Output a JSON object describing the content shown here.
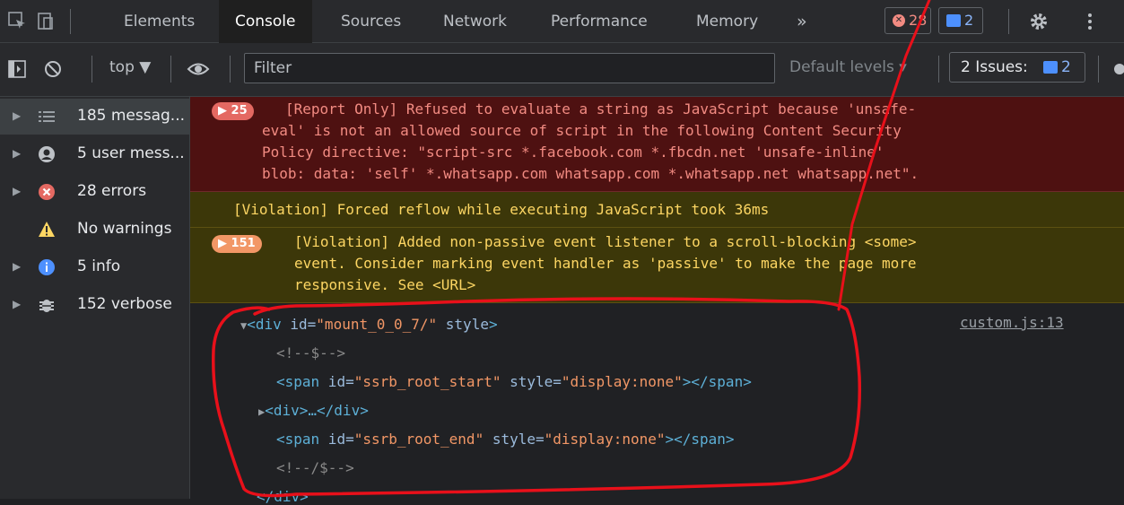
{
  "tabs": {
    "items": [
      {
        "label": "Elements"
      },
      {
        "label": "Console"
      },
      {
        "label": "Sources"
      },
      {
        "label": "Network"
      },
      {
        "label": "Performance"
      },
      {
        "label": "Memory"
      }
    ],
    "more": "»",
    "error_count": "28",
    "message_count": "2"
  },
  "toolbar": {
    "context": "top ▼",
    "filter_placeholder": "Filter",
    "levels": "Default levels ▾",
    "issues_label": "2 Issues:",
    "issues_count": "2"
  },
  "sidebar": {
    "items": [
      {
        "label": "185 messag...",
        "icon": "list-icon"
      },
      {
        "label": "5 user mess...",
        "icon": "user-icon"
      },
      {
        "label": "28 errors",
        "icon": "error-icon"
      },
      {
        "label": "No warnings",
        "icon": "warning-icon"
      },
      {
        "label": "5 info",
        "icon": "info-icon"
      },
      {
        "label": "152 verbose",
        "icon": "bug-icon"
      }
    ]
  },
  "console": {
    "error_message": {
      "count": "25",
      "lines": [
        "[Report Only] Refused to evaluate a string as JavaScript because 'unsafe-",
        "eval' is not an allowed source of script in the following Content Security",
        "Policy directive: \"script-src *.facebook.com *.fbcdn.net 'unsafe-inline'",
        "blob: data: 'self' *.whatsapp.com whatsapp.com *.whatsapp.net whatsapp.net\"."
      ]
    },
    "violation_1": "[Violation] Forced reflow while executing JavaScript took 36ms",
    "violation_2": {
      "count": "151",
      "lines": [
        "[Violation] Added non-passive event listener to a scroll-blocking <some>",
        "event. Consider marking event handler as 'passive' to make the page more",
        "responsive. See <URL>"
      ]
    },
    "source_link": "custom.js:13",
    "dom": {
      "line1_tag_open": "<div",
      "line1_attr1": " id=",
      "line1_val1": "\"mount_0_0_7/\"",
      "line1_attr2": " style",
      "line1_tag_close": ">",
      "line2": "<!--$-->",
      "line3_tag_open": "<span",
      "line3_attr1": " id=",
      "line3_val1": "\"ssrb_root_start\"",
      "line3_attr2": " style=",
      "line3_val2": "\"display:none\"",
      "line3_tag_close": "></span>",
      "line4": "<div>…</div>",
      "line5_tag_open": "<span",
      "line5_attr1": " id=",
      "line5_val1": "\"ssrb_root_end\"",
      "line5_attr2": " style=",
      "line5_val2": "\"display:none\"",
      "line5_tag_close": "></span>",
      "line6": "<!--/$-->",
      "line7": "</div>"
    }
  },
  "colors": {
    "annotation": "#e8101a",
    "error_bg": "#4e1111",
    "warning_bg": "#3c3709"
  }
}
